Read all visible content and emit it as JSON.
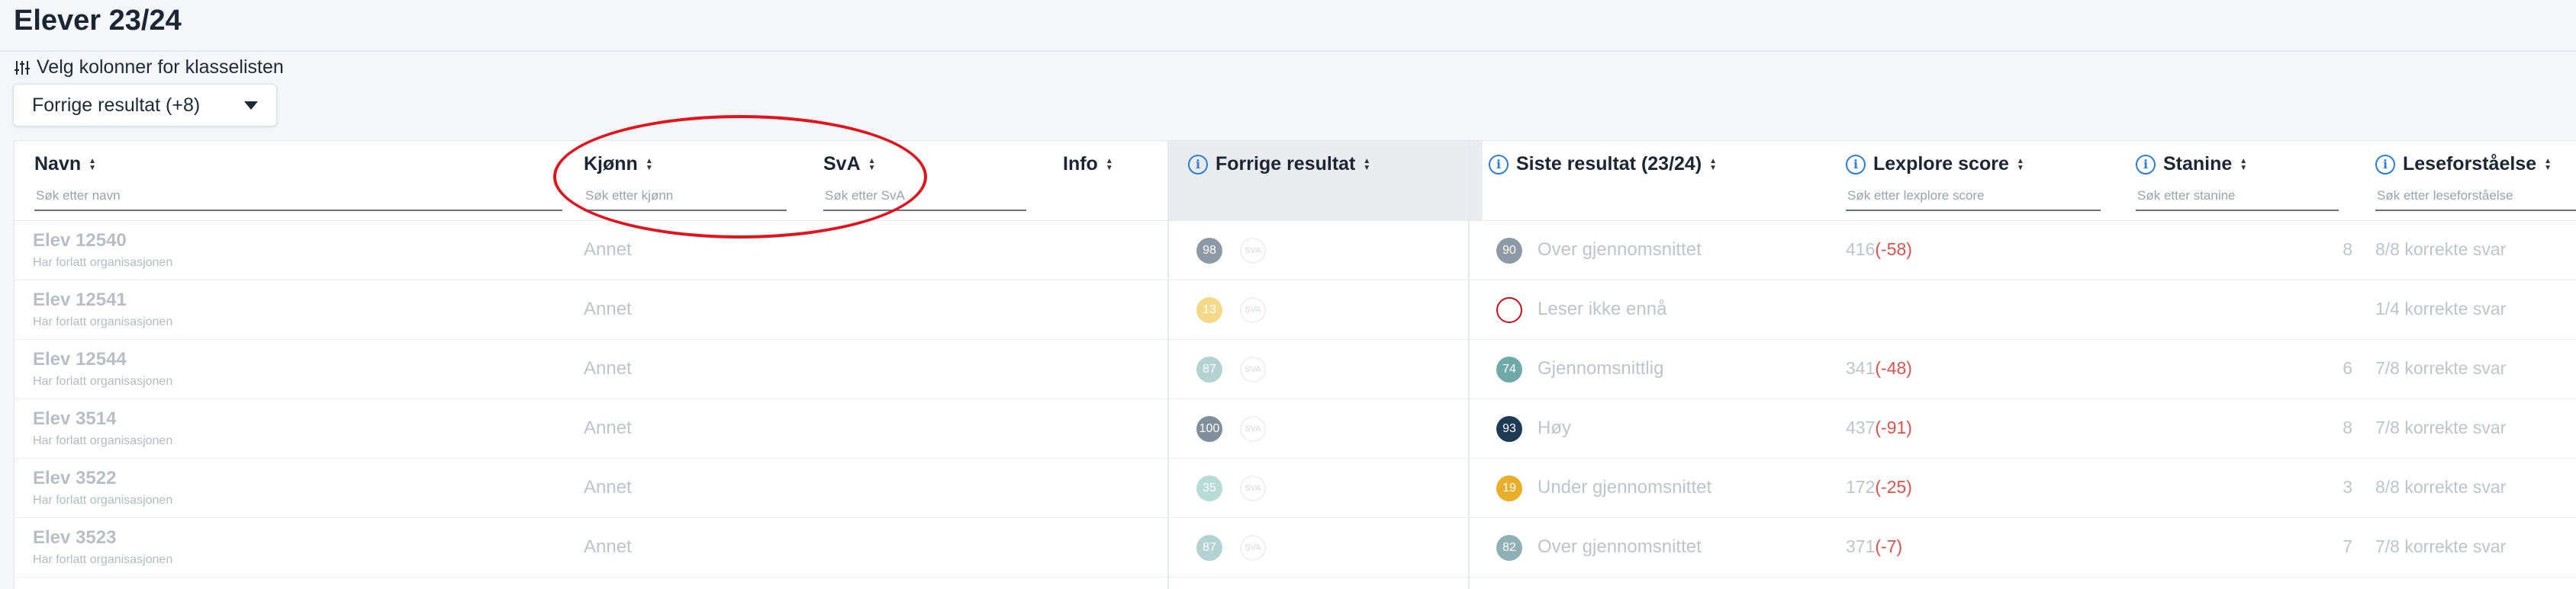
{
  "page": {
    "title": "Elever 23/24"
  },
  "column_chooser": {
    "label": "Velg kolonner for klasselisten",
    "icon": "sliders-icon"
  },
  "dropdown": {
    "selected": "Forrige resultat (+8)"
  },
  "columns": {
    "navn": {
      "label": "Navn",
      "placeholder": "Søk etter navn"
    },
    "kjonn": {
      "label": "Kjønn",
      "placeholder": "Søk etter kjønn"
    },
    "sva": {
      "label": "SvA",
      "placeholder": "Søk etter SvA"
    },
    "info": {
      "label": "Info"
    },
    "forrige": {
      "label": "Forrige resultat"
    },
    "siste": {
      "label": "Siste resultat (23/24)"
    },
    "lexplore": {
      "label": "Lexplore score",
      "placeholder": "Søk etter lexplore score"
    },
    "stanine": {
      "label": "Stanine",
      "placeholder": "Søk etter stanine"
    },
    "lese": {
      "label": "Leseforståelse",
      "placeholder": "Søk etter leseforståelse"
    }
  },
  "rows": [
    {
      "name": "Elev 12540",
      "status": "Har forlatt organisasjonen",
      "gender": "Annet",
      "prev_score": "98",
      "prev_color": "#8d9aa6",
      "sva": "SVA",
      "last_score": "90",
      "last_color": "#8d9aa6",
      "last_text": "Over gjennomsnittet",
      "lex": "416",
      "lex_delta": "(-58)",
      "stanine": "8",
      "lese": "8/8 korrekte svar"
    },
    {
      "name": "Elev 12541",
      "status": "Har forlatt organisasjonen",
      "gender": "Annet",
      "prev_score": "13",
      "prev_color": "#f5d98a",
      "sva": "SVA",
      "last_score": "",
      "last_color": "",
      "last_text": "Leser ikke ennå",
      "lex": "",
      "lex_delta": "",
      "stanine": "",
      "lese": "1/4 korrekte svar"
    },
    {
      "name": "Elev 12544",
      "status": "Har forlatt organisasjonen",
      "gender": "Annet",
      "prev_score": "87",
      "prev_color": "#b4d2d1",
      "sva": "SVA",
      "last_score": "74",
      "last_color": "#6fa9a8",
      "last_text": "Gjennomsnittlig",
      "lex": "341",
      "lex_delta": "(-48)",
      "stanine": "6",
      "lese": "7/8 korrekte svar"
    },
    {
      "name": "Elev 3514",
      "status": "Har forlatt organisasjonen",
      "gender": "Annet",
      "prev_score": "100",
      "prev_color": "#7f8f9c",
      "sva": "SVA",
      "last_score": "93",
      "last_color": "#1f3b54",
      "last_text": "Høy",
      "lex": "437",
      "lex_delta": "(-91)",
      "stanine": "8",
      "lese": "7/8 korrekte svar"
    },
    {
      "name": "Elev 3522",
      "status": "Har forlatt organisasjonen",
      "gender": "Annet",
      "prev_score": "35",
      "prev_color": "#b7dcd7",
      "sva": "SVA",
      "last_score": "19",
      "last_color": "#e8ae2c",
      "last_text": "Under gjennomsnittet",
      "lex": "172",
      "lex_delta": "(-25)",
      "stanine": "3",
      "lese": "8/8 korrekte svar"
    },
    {
      "name": "Elev 3523",
      "status": "Har forlatt organisasjonen",
      "gender": "Annet",
      "prev_score": "87",
      "prev_color": "#b4d2d1",
      "sva": "SVA",
      "last_score": "82",
      "last_color": "#8fb0b4",
      "last_text": "Over gjennomsnittet",
      "lex": "371",
      "lex_delta": "(-7)",
      "stanine": "7",
      "lese": "7/8 korrekte svar"
    }
  ]
}
